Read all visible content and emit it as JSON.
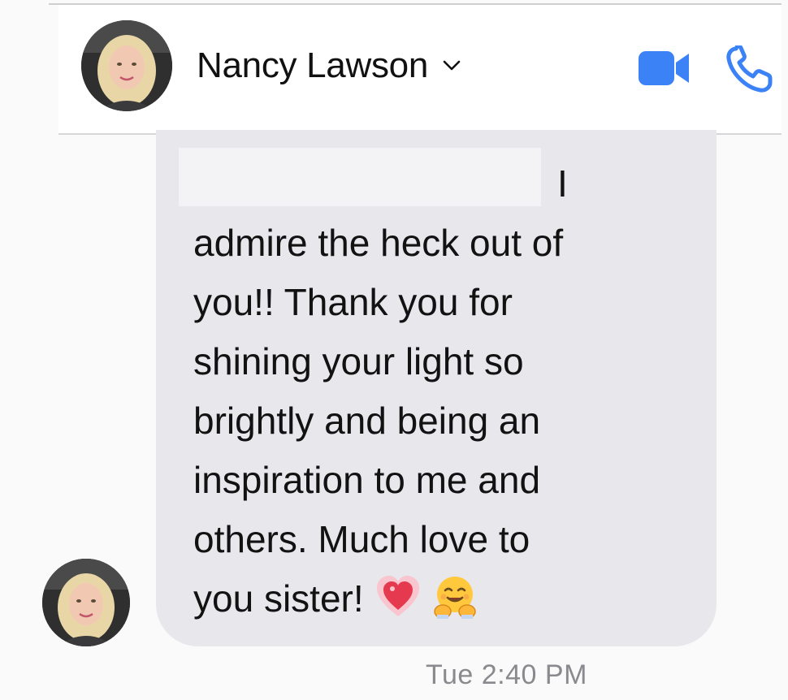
{
  "header": {
    "contact_name": "Nancy Lawson",
    "icons": {
      "dropdown": "chevron-down-icon",
      "video": "video-camera-icon",
      "call": "phone-icon"
    },
    "accent_color": "#3b82f6"
  },
  "message": {
    "lines": [
      "I",
      "admire the heck out of",
      "you!! Thank you for",
      "shining your light so",
      "brightly and being an",
      "inspiration to me and",
      "others. Much love to",
      "you sister!"
    ],
    "emojis": [
      "sparkling-heart-emoji",
      "hugging-face-emoji"
    ],
    "bubble_color": "#e8e8ec",
    "redacted_region": true
  },
  "timestamp": "Tue 2:40 PM"
}
